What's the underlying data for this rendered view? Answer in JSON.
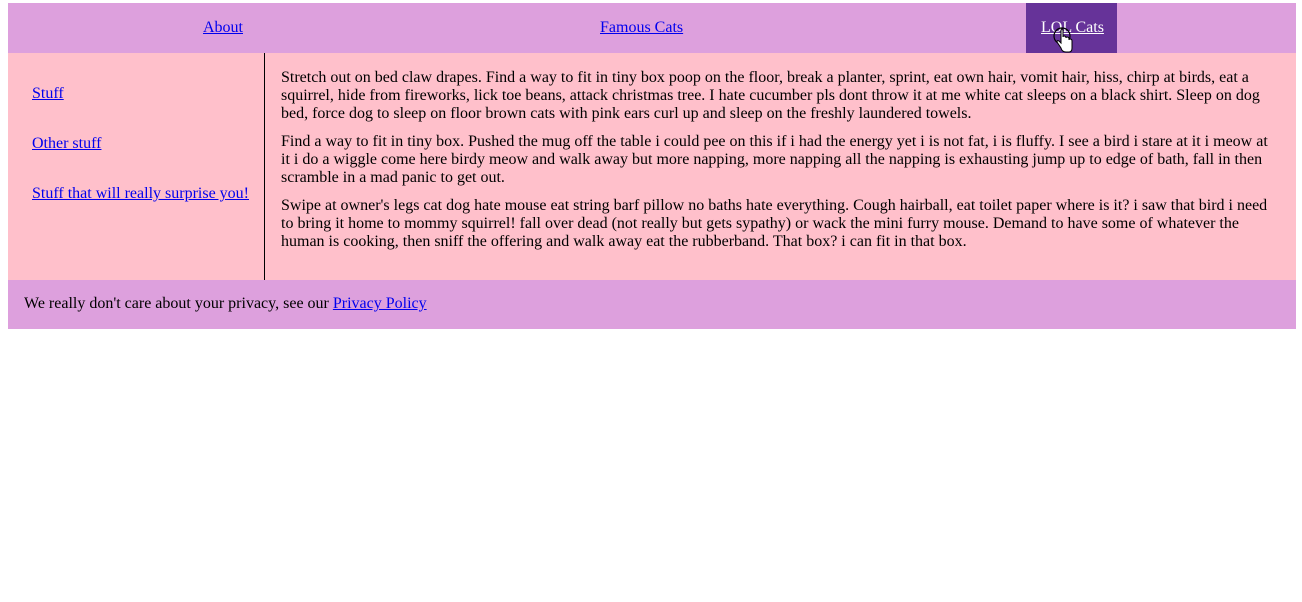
{
  "nav": {
    "about": "About",
    "famous_cats": "Famous Cats",
    "lol_cats": "LOL Cats"
  },
  "sidebar": {
    "items": [
      {
        "label": "Stuff"
      },
      {
        "label": "Other stuff"
      },
      {
        "label": "Stuff that will really surprise you!"
      }
    ]
  },
  "content": {
    "paragraphs": [
      "Stretch out on bed claw drapes. Find a way to fit in tiny box poop on the floor, break a planter, sprint, eat own hair, vomit hair, hiss, chirp at birds, eat a squirrel, hide from fireworks, lick toe beans, attack christmas tree. I hate cucumber pls dont throw it at me white cat sleeps on a black shirt. Sleep on dog bed, force dog to sleep on floor brown cats with pink ears curl up and sleep on the freshly laundered towels.",
      "Find a way to fit in tiny box. Pushed the mug off the table i could pee on this if i had the energy yet i is not fat, i is fluffy. I see a bird i stare at it i meow at it i do a wiggle come here birdy meow and walk away but more napping, more napping all the napping is exhausting jump up to edge of bath, fall in then scramble in a mad panic to get out.",
      "Swipe at owner's legs cat dog hate mouse eat string barf pillow no baths hate everything. Cough hairball, eat toilet paper where is it? i saw that bird i need to bring it home to mommy squirrel! fall over dead (not really but gets sypathy) or wack the mini furry mouse. Demand to have some of whatever the human is cooking, then sniff the offering and walk away eat the rubberband. That box? i can fit in that box."
    ]
  },
  "footer": {
    "text": "We really don't care about your privacy, see our ",
    "link": "Privacy Policy"
  },
  "icons": {
    "cursor": "hand-pointer-icon"
  },
  "colors": {
    "nav_bg": "#dda0dd",
    "nav_active_bg": "#663399",
    "body_bg": "#ffc0cb",
    "link": "#0000ee"
  }
}
